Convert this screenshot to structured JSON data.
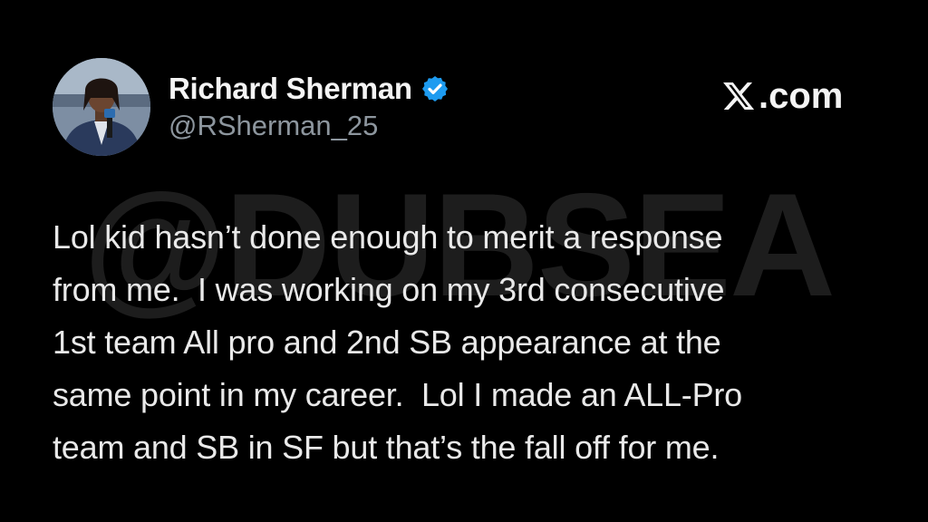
{
  "header": {
    "display_name": "Richard Sherman",
    "handle": "@RSherman_25",
    "verified": true,
    "avatar_icon": "profile-photo",
    "verified_icon": "verified-badge-icon",
    "verified_color": "#1d9bf0"
  },
  "brand": {
    "domain": ".com",
    "logo_icon": "x-logo-icon"
  },
  "watermark": "@DUBSEA",
  "tweet": {
    "lines": [
      "Lol kid hasn’t done enough to merit a response",
      "from me.  I was working on my 3rd consecutive",
      "1st team All pro and 2nd SB appearance at the",
      "same point in my career.  Lol I made an ALL-Pro",
      "team and SB in SF but that’s the fall off for me."
    ]
  },
  "colors": {
    "background": "#000000",
    "text": "#e7e9ea",
    "handle": "#8d969e",
    "watermark": "#1d1d1d"
  }
}
